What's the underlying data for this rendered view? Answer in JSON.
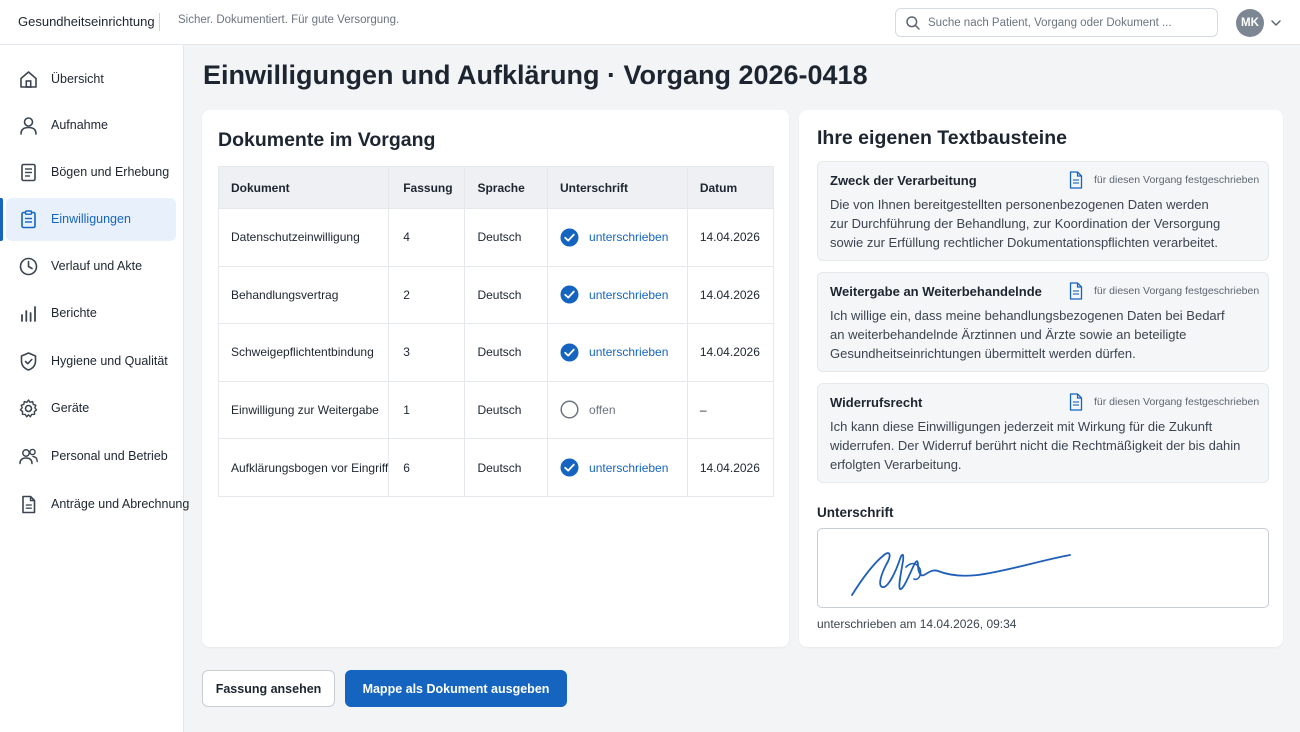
{
  "header": {
    "brand": "Gesundheitseinrichtung",
    "tagline": "Sicher. Dokumentiert. Für gute Versorgung.",
    "search_placeholder": "Suche nach Patient, Vorgang oder Dokument ...",
    "user_initials": "MK"
  },
  "sidebar": {
    "items": [
      {
        "label": "Übersicht",
        "icon": "home-icon"
      },
      {
        "label": "Aufnahme",
        "icon": "user-icon"
      },
      {
        "label": "Bögen und Erhebung",
        "icon": "form-icon"
      },
      {
        "label": "Einwilligungen",
        "icon": "clipboard-icon",
        "active": true
      },
      {
        "label": "Verlauf und Akte",
        "icon": "clock-icon"
      },
      {
        "label": "Berichte",
        "icon": "bar-chart-icon"
      },
      {
        "label": "Hygiene und Qualität",
        "icon": "shield-icon"
      },
      {
        "label": "Geräte",
        "icon": "gear-icon"
      },
      {
        "label": "Personal und Betrieb",
        "icon": "users-icon"
      },
      {
        "label": "Anträge und Abrechnung",
        "icon": "document-icon"
      }
    ]
  },
  "main": {
    "title": "Einwilligungen und Aufklärung · Vorgang 2026-0418"
  },
  "documents": {
    "title": "Dokumente im Vorgang",
    "columns": [
      "Dokument",
      "Fassung",
      "Sprache",
      "Unterschrift",
      "Datum"
    ],
    "rows": [
      {
        "name": "Datenschutzeinwilligung",
        "version": "4",
        "language": "Deutsch",
        "status": "unterschrieben",
        "signed": true,
        "date": "14.04.2026"
      },
      {
        "name": "Behandlungsvertrag",
        "version": "2",
        "language": "Deutsch",
        "status": "unterschrieben",
        "signed": true,
        "date": "14.04.2026"
      },
      {
        "name": "Schweigepflichtentbindung",
        "version": "3",
        "language": "Deutsch",
        "status": "unterschrieben",
        "signed": true,
        "date": "14.04.2026"
      },
      {
        "name": "Einwilligung zur Weitergabe",
        "version": "1",
        "language": "Deutsch",
        "status": "offen",
        "signed": false,
        "date": "–"
      },
      {
        "name": "Aufklärungsbogen vor Eingriff",
        "version": "6",
        "language": "Deutsch",
        "status": "unterschrieben",
        "signed": true,
        "date": "14.04.2026"
      }
    ]
  },
  "textblocks": {
    "title": "Ihre eigenen Textbausteine",
    "fixed_label": "für diesen Vorgang festgeschrieben",
    "blocks": [
      {
        "title": "Zweck der Verarbeitung",
        "lines": [
          "Die von Ihnen bereitgestellten personenbezogenen Daten werden",
          "zur Durchführung der Behandlung, zur Koordination der Versorgung",
          "sowie zur Erfüllung rechtlicher Dokumentationspflichten verarbeitet."
        ]
      },
      {
        "title": "Weitergabe an Weiterbehandelnde",
        "lines": [
          "Ich willige ein, dass meine behandlungsbezogenen Daten bei Bedarf",
          "an weiterbehandelnde Ärztinnen und Ärzte sowie an beteiligte",
          "Gesundheitseinrichtungen übermittelt werden dürfen."
        ]
      },
      {
        "title": "Widerrufsrecht",
        "lines": [
          "Ich kann diese Einwilligungen jederzeit mit Wirkung für die Zukunft",
          "widerrufen. Der Widerruf berührt nicht die Rechtmäßigkeit der bis dahin",
          "erfolgten Verarbeitung."
        ]
      }
    ]
  },
  "signature": {
    "title": "Unterschrift",
    "signed_at": "unterschrieben am 14.04.2026, 09:34"
  },
  "actions": {
    "view_version": "Fassung ansehen",
    "export": "Mappe als Dokument ausgeben"
  },
  "colors": {
    "accent": "#1565c0",
    "active_nav_bg": "#e8f0fb",
    "open_status": "#6b7480"
  }
}
